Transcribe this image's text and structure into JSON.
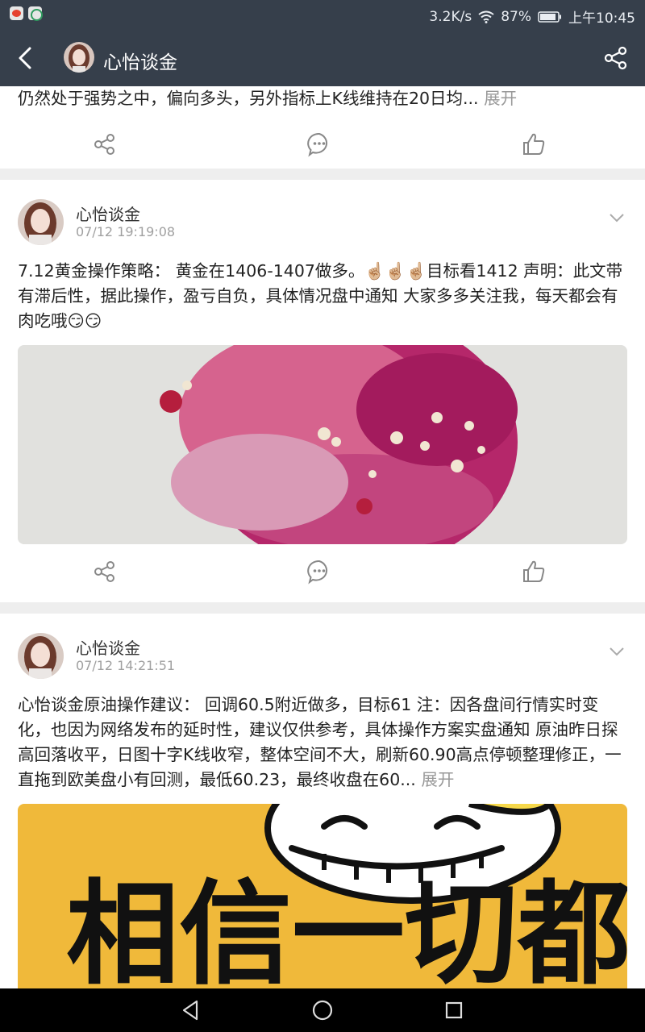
{
  "status_bar": {
    "net_speed": "3.2K/s",
    "battery": "87%",
    "time": "上午10:45",
    "icons": [
      "weibo-notification-icon",
      "app-notification-icon",
      "wifi-icon",
      "battery-icon"
    ]
  },
  "title_bar": {
    "title": "心怡谈金",
    "icons": [
      "back-arrow-icon",
      "share-icon"
    ]
  },
  "feed": {
    "partial_post": {
      "text": "仍然处于强势之中，偏向多头，另外指标上K线维持在20日均...",
      "more": "展开"
    },
    "posts": [
      {
        "author": "心怡谈金",
        "time": "07/12 19:19:08",
        "text": "7.12黄金操作策略： 黄金在1406-1407做多。☝🏼☝🏼☝🏼目标看1412 声明：此文带有滞后性，据此操作，盈亏自负，具体情况盘中通知 大家多多关注我，每天都会有肉吃哦😏😏",
        "image": "pink-raspberry-ice-cream-photo"
      },
      {
        "author": "心怡谈金",
        "time": "07/12 14:21:51",
        "text": "心怡谈金原油操作建议： 回调60.5附近做多，目标61 注：因各盘间行情实时变化，也因为网络发布的延时性，建议仅供参考，具体操作方案实盘通知 原油昨日探高回落收平，日图十字K线收窄，整体空间不大，刷新60.90高点停顿整理修正，一直拖到欧美盘小有回测，最低60.23，最终收盘在60...",
        "more": "展开",
        "image": "yellow-smiley-poster"
      }
    ]
  },
  "poster": {
    "text": "相信一切都会"
  },
  "colors": {
    "header_bg": "#363f4b",
    "divider": "#eeeeee",
    "muted_text": "#999999",
    "poster_yellow": "#f0b93a"
  }
}
